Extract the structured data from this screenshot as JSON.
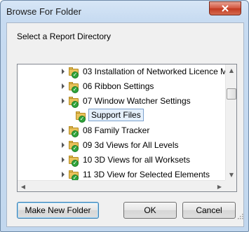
{
  "window": {
    "title": "Browse For Folder"
  },
  "dialog": {
    "prompt": "Select a Report Directory"
  },
  "tree": {
    "items": [
      {
        "label": "03 Installation of Networked Licence M",
        "selected": false,
        "expander": true
      },
      {
        "label": "06 Ribbon Settings",
        "selected": false,
        "expander": true
      },
      {
        "label": "07 Window Watcher Settings",
        "selected": false,
        "expander": true
      },
      {
        "label": "Support Files",
        "selected": true,
        "expander": false
      },
      {
        "label": "08 Family Tracker",
        "selected": false,
        "expander": true
      },
      {
        "label": "09 3d Views for All Levels",
        "selected": false,
        "expander": true
      },
      {
        "label": "10 3D Views for all Worksets",
        "selected": false,
        "expander": true
      },
      {
        "label": "11 3D View for Selected Elements",
        "selected": false,
        "expander": true
      }
    ]
  },
  "buttons": {
    "make_new_folder": "Make New Folder",
    "ok": "OK",
    "cancel": "Cancel"
  },
  "icons": {
    "close": "close-icon",
    "folder": "folder-check-icon",
    "expand": "chevron-right-icon"
  },
  "colors": {
    "close_red": "#c23a20",
    "selection_bg": "#e5f0fb",
    "folder_yellow": "#e8c25a",
    "check_green": "#2fa43a"
  }
}
